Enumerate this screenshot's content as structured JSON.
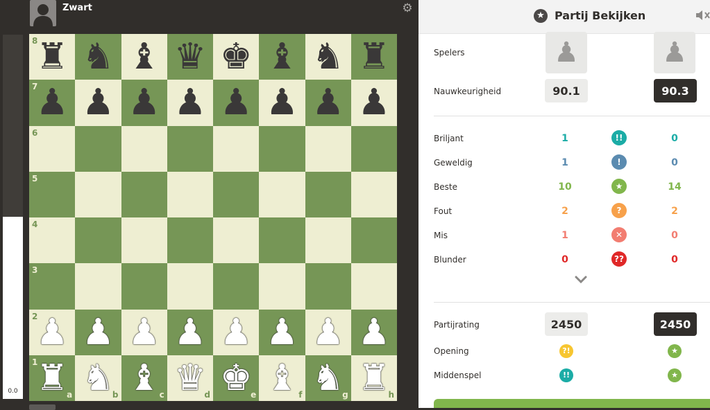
{
  "top_player": {
    "name": "Zwart"
  },
  "eval": {
    "score": "0.0",
    "white_fraction": 0.5
  },
  "board": {
    "light_color": "#eeeed2",
    "dark_color": "#769656",
    "rank_labels": [
      "8",
      "7",
      "6",
      "5",
      "4",
      "3",
      "2",
      "1"
    ],
    "file_labels": [
      "a",
      "b",
      "c",
      "d",
      "e",
      "f",
      "g",
      "h"
    ],
    "position": [
      "rnbqkbnr",
      "pppppppp",
      "........",
      "........",
      "........",
      "........",
      "PPPPPPPP",
      "RNBQKBNR"
    ]
  },
  "panel": {
    "title": "Partij Bekijken",
    "players_label": "Spelers",
    "accuracy_label": "Nauwkeurigheid",
    "accuracy_white": "90.1",
    "accuracy_black": "90.3",
    "classifications": [
      {
        "label": "Briljant",
        "white": "1",
        "black": "0",
        "symbol": "!!",
        "color": "#1baca6"
      },
      {
        "label": "Geweldig",
        "white": "1",
        "black": "0",
        "symbol": "!",
        "color": "#5b8bb0"
      },
      {
        "label": "Beste",
        "white": "10",
        "black": "14",
        "symbol": "★",
        "color": "#81b64c"
      },
      {
        "label": "Fout",
        "white": "2",
        "black": "2",
        "symbol": "?",
        "color": "#f7a14b"
      },
      {
        "label": "Mis",
        "white": "1",
        "black": "0",
        "symbol": "✕",
        "color": "#f27d71"
      },
      {
        "label": "Blunder",
        "white": "0",
        "black": "0",
        "symbol": "??",
        "color": "#e02828"
      }
    ],
    "game_rating_label": "Partijrating",
    "game_rating_white": "2450",
    "game_rating_black": "2450",
    "phases": [
      {
        "label": "Opening",
        "white_symbol": "?!",
        "white_color": "#f7c631",
        "black_symbol": "★",
        "black_color": "#81b64c"
      },
      {
        "label": "Middenspel",
        "white_symbol": "!!",
        "white_color": "#1baca6",
        "black_symbol": "★",
        "black_color": "#81b64c"
      }
    ]
  },
  "icons": {
    "settings": "gear-icon",
    "header": "star-icon",
    "sound": "sound-muted-icon",
    "expand": "chevron-down-icon",
    "player_avatar": "pawn-icon"
  }
}
